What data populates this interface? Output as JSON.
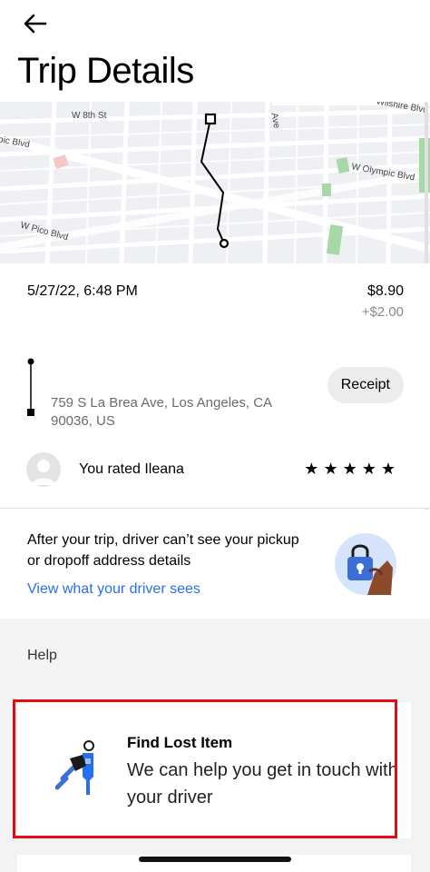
{
  "header": {
    "title": "Trip Details"
  },
  "map": {
    "streets": [
      "W 8th St",
      "Ave",
      "Wilshire Blvd",
      "pic Blvd",
      "W Olympic Blvd",
      "W Pico Blvd"
    ]
  },
  "trip": {
    "datetime": "5/27/22, 6:48 PM",
    "fare": "$8.90",
    "tip": "+$2.00",
    "address": "759 S La Brea Ave, Los Angeles, CA 90036, US",
    "receipt_label": "Receipt",
    "rating_text": "You rated Ileana",
    "rating_stars": 5,
    "stars": [
      "★",
      "★",
      "★",
      "★",
      "★"
    ]
  },
  "privacy": {
    "text": "After your trip, driver can’t see your pickup or dropoff address details",
    "link": "View what your driver sees"
  },
  "help": {
    "title": "Help",
    "lost_item": {
      "title": "Find Lost Item",
      "description": "We can help you get in touch with your driver"
    }
  },
  "colors": {
    "link": "#276ef1",
    "highlight": "#e30b16",
    "map_background": "#eef0f3",
    "park": "#a8d8a8"
  },
  "icons": {
    "back": "arrow-left-icon",
    "lock": "lock-icon",
    "keys": "keys-icon",
    "avatar": "person-icon"
  }
}
